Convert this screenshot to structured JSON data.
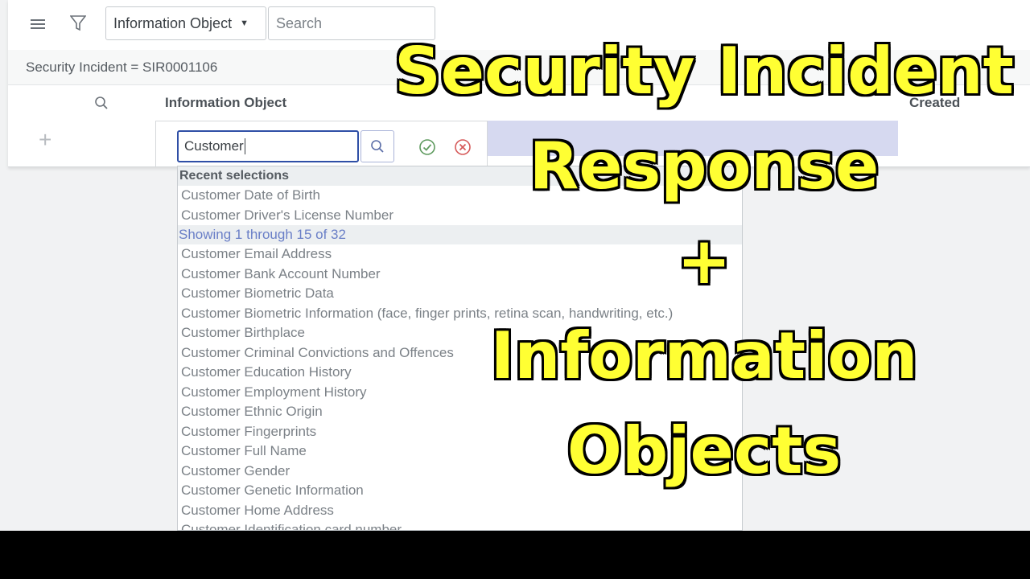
{
  "toolbar": {
    "table_selector_value": "Information Object",
    "search_placeholder": "Search"
  },
  "breadcrumb": "Security Incident = SIR0001106",
  "columns": {
    "information_object": "Information Object",
    "created": "Created"
  },
  "editor": {
    "input_value": "Customer"
  },
  "dropdown": {
    "recent_header": "Recent selections",
    "recent": [
      "Customer Date of Birth",
      "Customer Driver's License Number"
    ],
    "showing": "Showing 1 through 15 of 32",
    "items": [
      "Customer Email Address",
      "Customer Bank Account Number",
      "Customer Biometric Data",
      "Customer Biometric Information (face, finger prints, retina scan, handwriting, etc.)",
      "Customer Birthplace",
      "Customer Criminal Convictions and Offences",
      "Customer Education History",
      "Customer Employment History",
      "Customer Ethnic Origin",
      "Customer Fingerprints",
      "Customer Full Name",
      "Customer Gender",
      "Customer Genetic Information",
      "Customer Home Address",
      "Customer Identification card number"
    ]
  },
  "overlay_title": {
    "line1": "Security Incident",
    "line2": "Response",
    "line3": "+",
    "line4": "Information",
    "line5": "Objects"
  },
  "colors": {
    "accent": "#2f4fa6",
    "overlay_text": "#ffff33",
    "highlight": "#d6d9f0"
  }
}
